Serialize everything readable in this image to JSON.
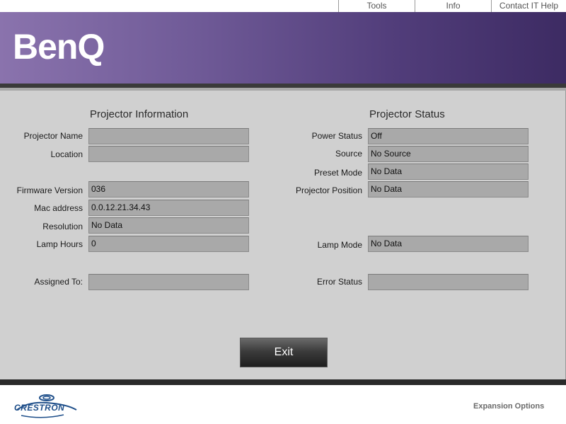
{
  "nav": {
    "items": [
      "Tools",
      "Info",
      "Contact IT Help"
    ]
  },
  "brand": {
    "logo": "BenQ",
    "accent": "#6f5a97"
  },
  "info": {
    "title": "Projector Information",
    "rows": [
      {
        "label": "Projector Name",
        "value": ""
      },
      {
        "label": "Location",
        "value": ""
      },
      {
        "label": "Firmware Version",
        "value": "036"
      },
      {
        "label": "Mac address",
        "value": "0.0.12.21.34.43"
      },
      {
        "label": "Resolution",
        "value": "No Data"
      },
      {
        "label": "Lamp Hours",
        "value": "0"
      },
      {
        "label": "Assigned To:",
        "value": ""
      }
    ]
  },
  "status": {
    "title": "Projector Status",
    "rows": [
      {
        "label": "Power Status",
        "value": "Off"
      },
      {
        "label": "Source",
        "value": "No Source"
      },
      {
        "label": "Preset Mode",
        "value": "No Data"
      },
      {
        "label": "Projector Position",
        "value": "No Data"
      },
      {
        "label": "Lamp Mode",
        "value": "No Data"
      },
      {
        "label": "Error Status",
        "value": ""
      }
    ]
  },
  "exit_label": "Exit",
  "footer": {
    "logo": "CRESTRON",
    "expansion": "Expansion Options"
  }
}
